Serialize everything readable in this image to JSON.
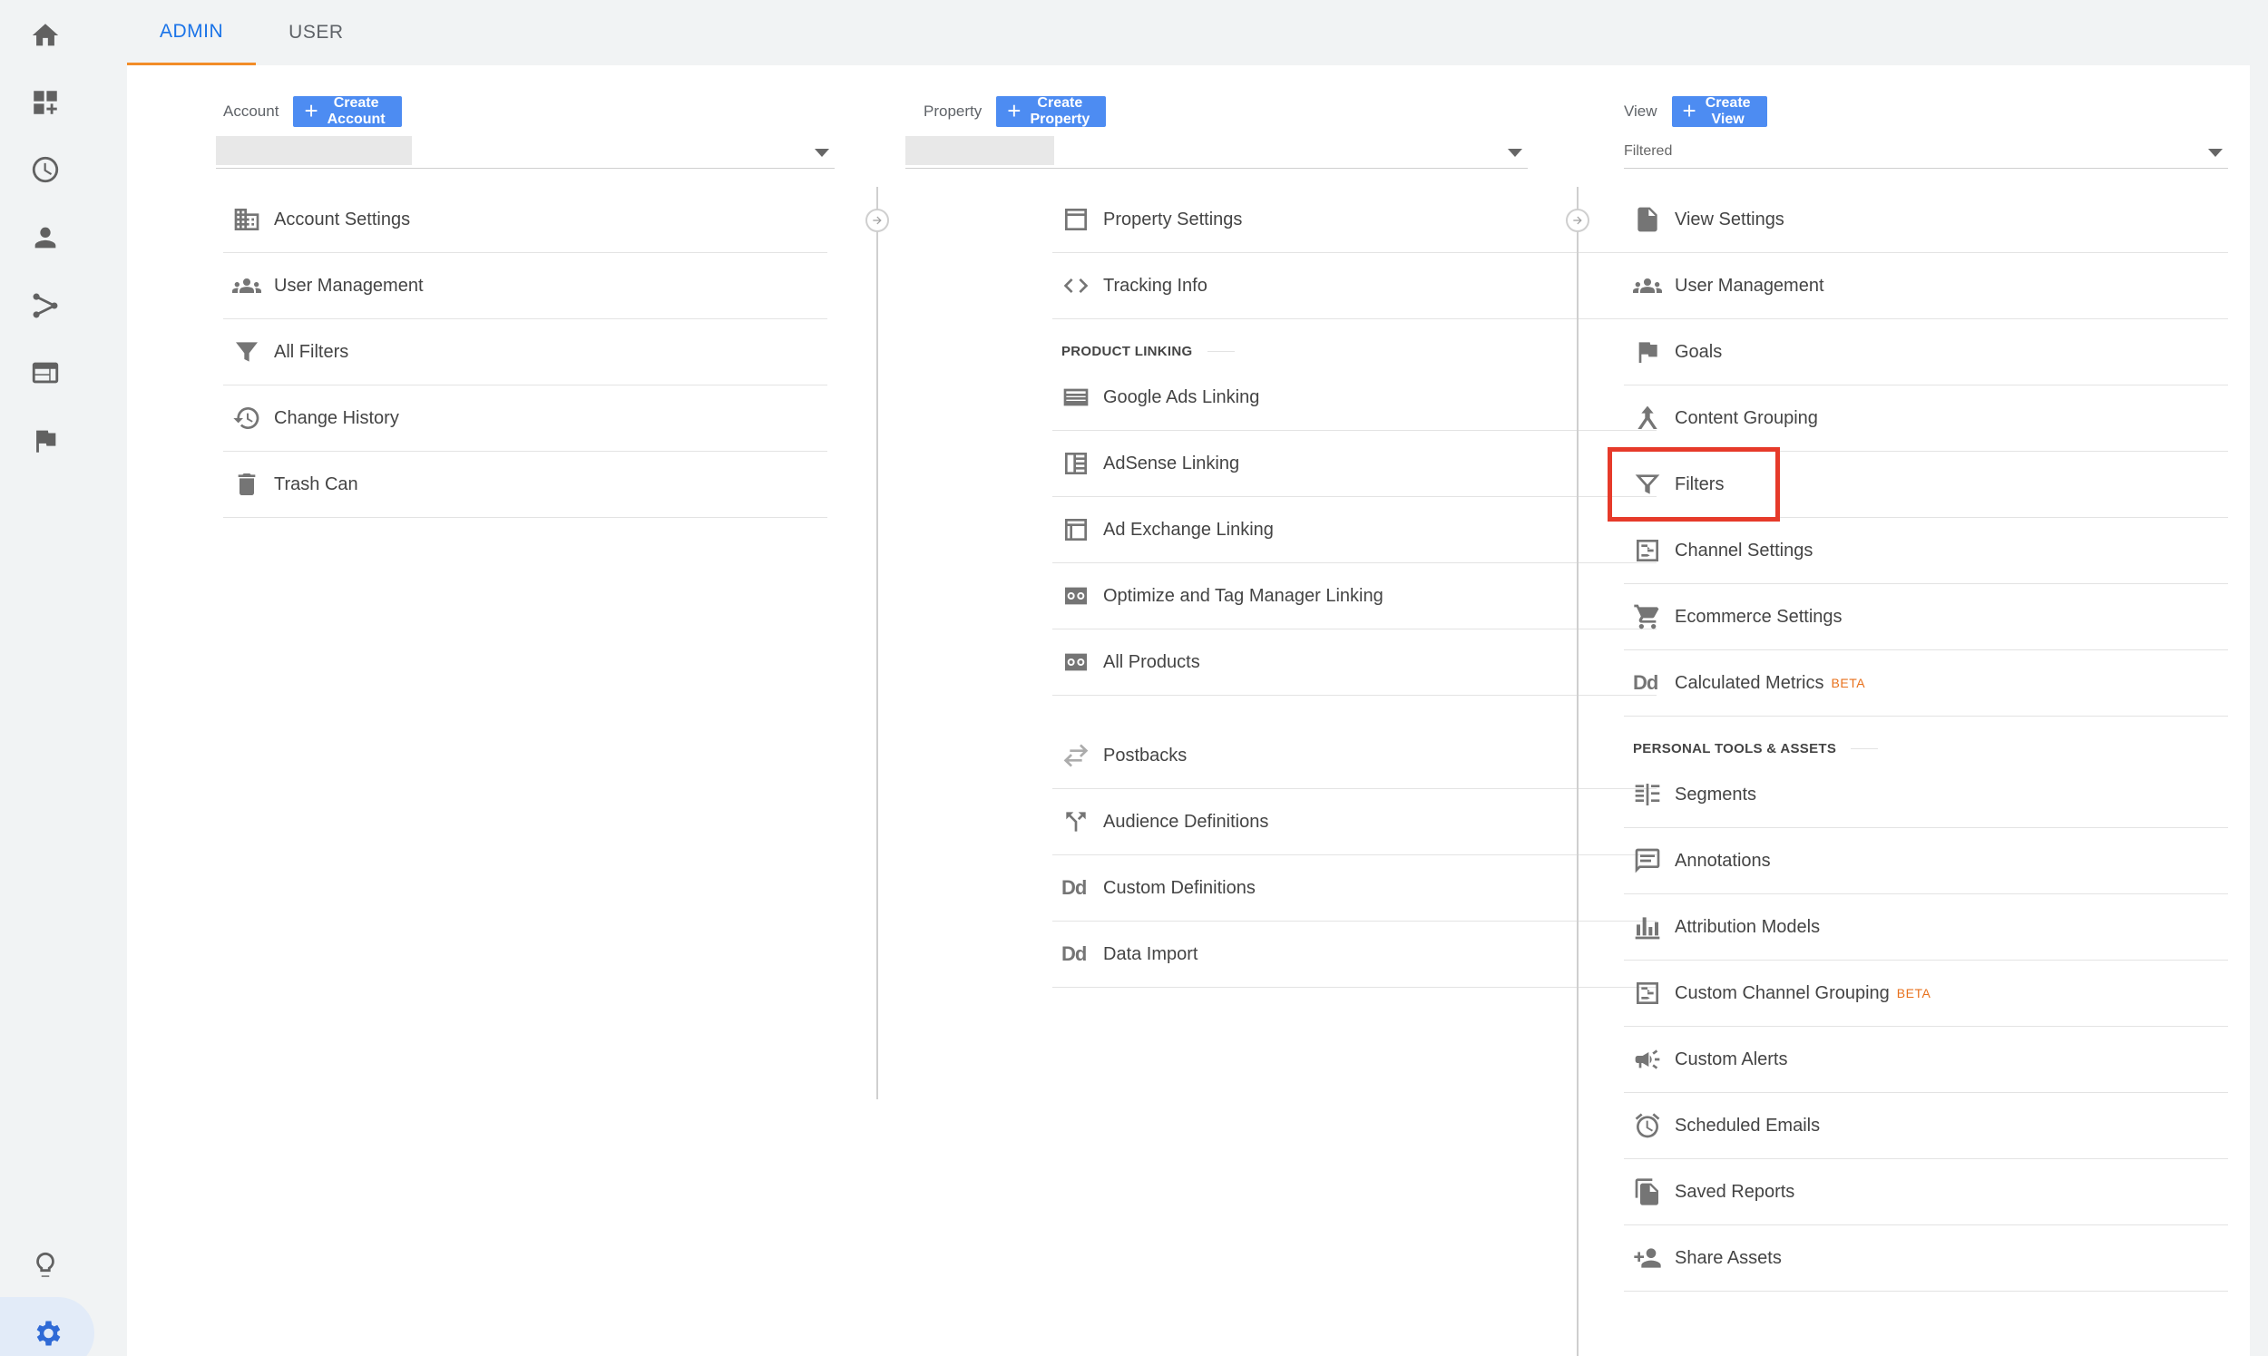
{
  "tabs": [
    {
      "label": "ADMIN",
      "active": true
    },
    {
      "label": "USER",
      "active": false
    }
  ],
  "rail": [
    "home-icon",
    "dashboard-icon",
    "clock-icon",
    "person-icon",
    "share-icon",
    "web-icon",
    "flag-icon",
    "lightbulb-icon",
    "gear-icon"
  ],
  "account": {
    "label": "Account",
    "create": "Create Account",
    "items": [
      {
        "label": "Account Settings",
        "icon": "building-icon"
      },
      {
        "label": "User Management",
        "icon": "people-icon"
      },
      {
        "label": "All Filters",
        "icon": "filter-icon"
      },
      {
        "label": "Change History",
        "icon": "history-icon"
      },
      {
        "label": "Trash Can",
        "icon": "trash-icon"
      }
    ]
  },
  "property": {
    "label": "Property",
    "create": "Create Property",
    "items": [
      {
        "label": "Property Settings",
        "icon": "window-icon"
      },
      {
        "label": "Tracking Info",
        "icon": "code-icon"
      }
    ],
    "section": "PRODUCT LINKING",
    "linking": [
      {
        "label": "Google Ads Linking",
        "icon": "ads-icon"
      },
      {
        "label": "AdSense Linking",
        "icon": "adsense-icon"
      },
      {
        "label": "Ad Exchange Linking",
        "icon": "window-icon"
      },
      {
        "label": "Optimize and Tag Manager Linking",
        "icon": "link-box-icon"
      },
      {
        "label": "All Products",
        "icon": "link-box-icon"
      }
    ],
    "more": [
      {
        "label": "Postbacks",
        "icon": "swap-icon"
      },
      {
        "label": "Audience Definitions",
        "icon": "fork-icon"
      },
      {
        "label": "Custom Definitions",
        "icon": "dd-icon"
      },
      {
        "label": "Data Import",
        "icon": "dd-icon"
      }
    ]
  },
  "view": {
    "label": "View",
    "create": "Create View",
    "selected": "Filtered",
    "items": [
      {
        "label": "View Settings",
        "icon": "document-icon"
      },
      {
        "label": "User Management",
        "icon": "people-icon"
      },
      {
        "label": "Goals",
        "icon": "flag-icon"
      },
      {
        "label": "Content Grouping",
        "icon": "grouping-icon"
      },
      {
        "label": "Filters",
        "icon": "filter-icon"
      },
      {
        "label": "Channel Settings",
        "icon": "channel-icon"
      },
      {
        "label": "Ecommerce Settings",
        "icon": "cart-icon"
      },
      {
        "label": "Calculated Metrics",
        "icon": "dd-icon",
        "badge": "BETA"
      }
    ],
    "section": "PERSONAL TOOLS & ASSETS",
    "tools": [
      {
        "label": "Segments",
        "icon": "segments-icon"
      },
      {
        "label": "Annotations",
        "icon": "comment-icon"
      },
      {
        "label": "Attribution Models",
        "icon": "bars-icon"
      },
      {
        "label": "Custom Channel Grouping",
        "icon": "channel-icon",
        "badge": "BETA"
      },
      {
        "label": "Custom Alerts",
        "icon": "megaphone-icon"
      },
      {
        "label": "Scheduled Emails",
        "icon": "alarm-icon"
      },
      {
        "label": "Saved Reports",
        "icon": "copy-icon"
      },
      {
        "label": "Share Assets",
        "icon": "person-add-icon"
      }
    ]
  },
  "colors": {
    "accent": "#4d8cf2",
    "active_tab": "#1a73e8",
    "tab_underline": "#f28c28",
    "highlight": "#e63a2a",
    "beta": "#e8711c"
  }
}
